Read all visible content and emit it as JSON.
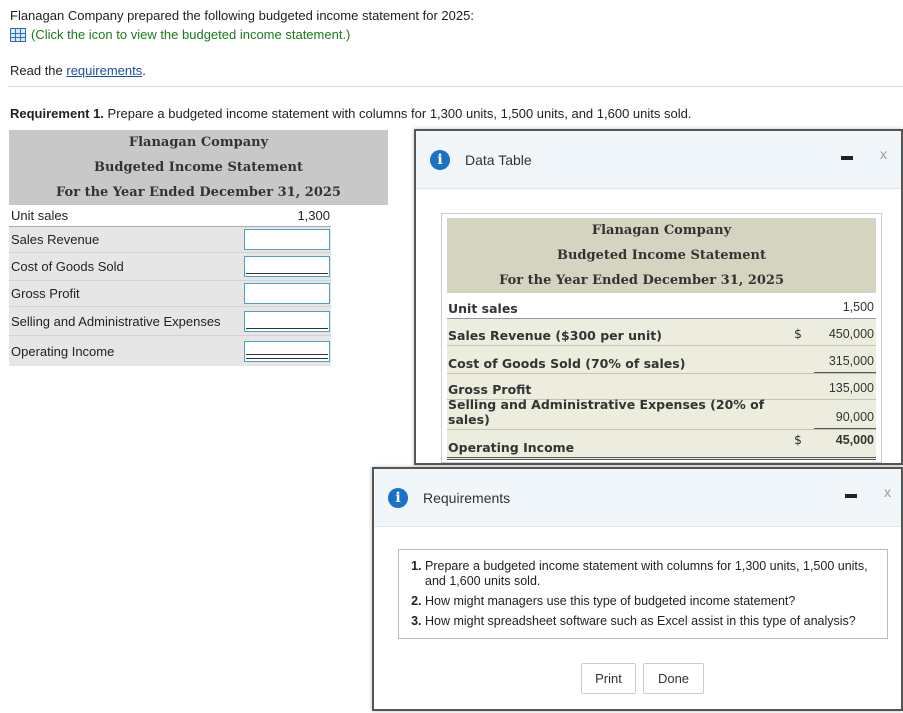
{
  "intro": "Flanagan Company prepared the following budgeted income statement for 2025:",
  "icon_link": "(Click the icon to view the budgeted income statement.)",
  "read_prefix": "Read the ",
  "read_link": "requirements",
  "read_suffix": ".",
  "req1_bold": "Requirement 1.",
  "req1_text": " Prepare a budgeted income statement with columns for 1,300 units, 1,500 units, and 1,600 units sold.",
  "main": {
    "company": "Flanagan Company",
    "statement": "Budgeted Income Statement",
    "period": "For the Year Ended December 31, 2025",
    "unit_sales_label": "Unit sales",
    "unit_sales_value": "1,300",
    "rows": [
      "Sales Revenue",
      "Cost of Goods Sold",
      "Gross Profit",
      "Selling and Administrative Expenses",
      "Operating Income"
    ]
  },
  "data_table": {
    "title": "Data Table",
    "company": "Flanagan Company",
    "statement": "Budgeted Income Statement",
    "period": "For the Year Ended December 31, 2025",
    "rows": [
      {
        "label": "Unit sales",
        "cur": "",
        "amt": "1,500"
      },
      {
        "label": "Sales Revenue ($300 per unit)",
        "cur": "$",
        "amt": "450,000"
      },
      {
        "label": "Cost of Goods Sold (70% of sales)",
        "cur": "",
        "amt": "315,000"
      },
      {
        "label": "Gross Profit",
        "cur": "",
        "amt": "135,000"
      },
      {
        "label": "Selling and Administrative Expenses (20% of sales)",
        "cur": "",
        "amt": "90,000"
      },
      {
        "label": "Operating Income",
        "cur": "$",
        "amt": "45,000"
      }
    ]
  },
  "requirements": {
    "title": "Requirements",
    "items": [
      "Prepare a budgeted income statement with columns for 1,300 units, 1,500 units, and 1,600 units sold.",
      "How might managers use this type of budgeted income statement?",
      "How might spreadsheet software such as Excel assist in this type of analysis?"
    ],
    "print_label": "Print",
    "done_label": "Done"
  },
  "close_glyph": "x",
  "info_glyph": "i",
  "colors": {
    "link": "#1a4ea8",
    "green_link": "#1b7a1b",
    "info": "#1a72c6",
    "input_border": "#4aa0c8"
  }
}
